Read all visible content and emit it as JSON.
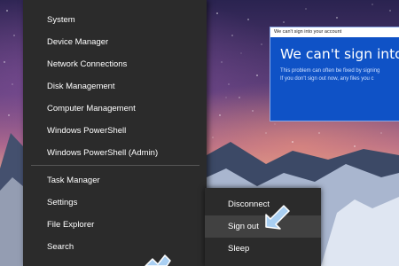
{
  "winx_menu": {
    "items": [
      {
        "label": "System"
      },
      {
        "label": "Device Manager"
      },
      {
        "label": "Network Connections"
      },
      {
        "label": "Disk Management"
      },
      {
        "label": "Computer Management"
      },
      {
        "label": "Windows PowerShell"
      },
      {
        "label": "Windows PowerShell (Admin)"
      },
      {
        "label": "Task Manager"
      },
      {
        "label": "Settings"
      },
      {
        "label": "File Explorer"
      },
      {
        "label": "Search"
      }
    ]
  },
  "shutdown_submenu": {
    "items": [
      {
        "label": "Disconnect"
      },
      {
        "label": "Sign out"
      },
      {
        "label": "Sleep"
      }
    ],
    "highlighted": "Sign out"
  },
  "error_dialog": {
    "title": "We can't sign into your account",
    "heading": "We can't sign into your",
    "body_line_1": "This problem can often be fixed by signing",
    "body_line_2": "If you don't sign out now, any files you c"
  },
  "colors": {
    "menu_background": "#2b2b2b",
    "menu_text": "#ffffff",
    "highlight": "#414141",
    "dialog_blue": "#0f52c6",
    "pointer": "#a9cff2"
  }
}
